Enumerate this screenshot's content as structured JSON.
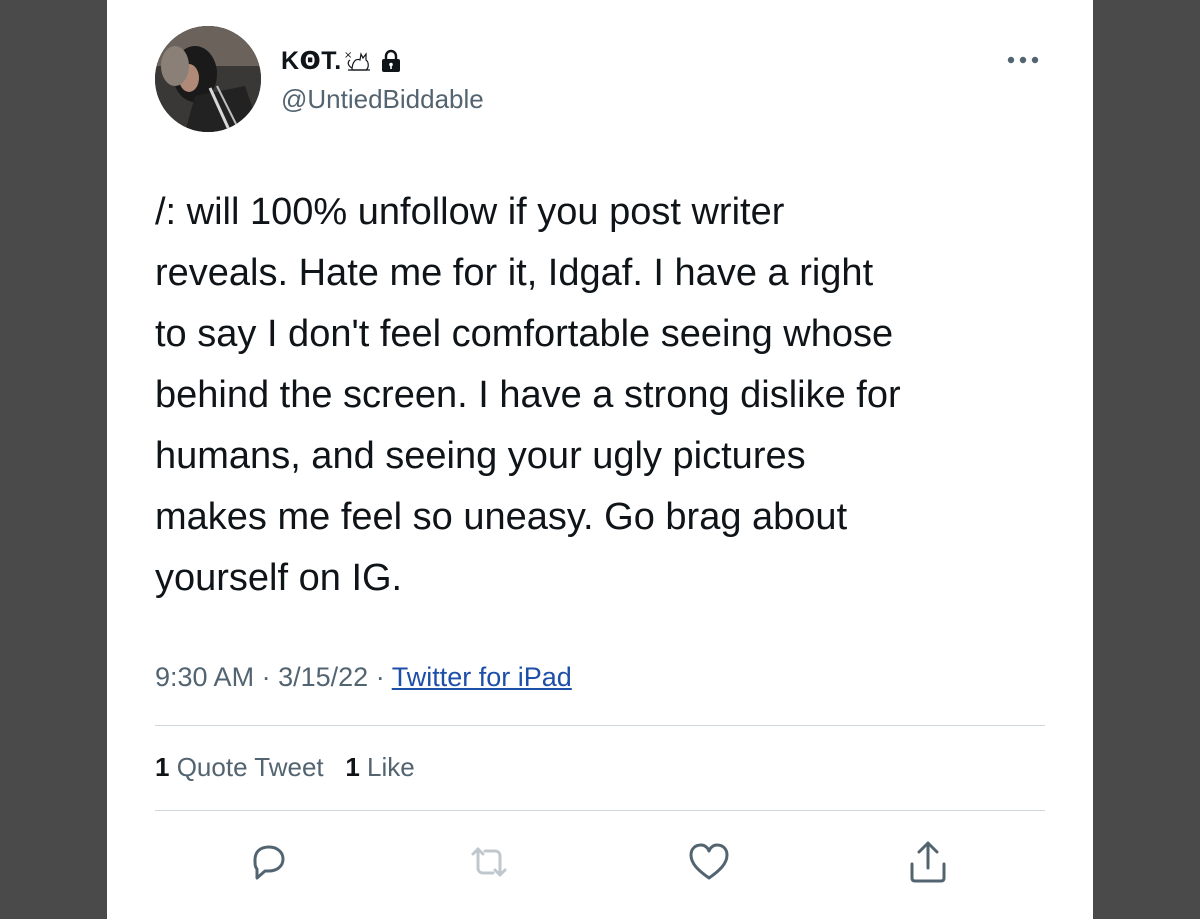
{
  "tweet": {
    "author": {
      "display_name": "KꙨT.",
      "handle": "@UntiedBiddable",
      "protected_icon": "lock-icon",
      "name_emoji": "cat-emoji"
    },
    "text_lines": [
      "/: will 100% unfollow if you post writer",
      "reveals. Hate me for it, Idgaf. I have a right",
      "to say I don't feel comfortable seeing whose",
      "behind the screen. I have a strong dislike for",
      "humans, and seeing your ugly pictures",
      "makes me feel so uneasy. Go brag about",
      "yourself on IG."
    ],
    "time": "9:30 AM",
    "separator": "·",
    "date": "3/15/22",
    "source": "Twitter for iPad",
    "stats": {
      "quote_count": "1",
      "quote_label": "Quote Tweet",
      "like_count": "1",
      "like_label": "Like"
    },
    "actions": [
      "reply-icon",
      "retweet-icon",
      "like-icon",
      "share-icon"
    ]
  },
  "colors": {
    "text_primary": "#0f1419",
    "text_secondary": "#536471",
    "link": "#1d4ea8",
    "divider": "#cfd9de",
    "background_outer": "#4a4a4a"
  }
}
